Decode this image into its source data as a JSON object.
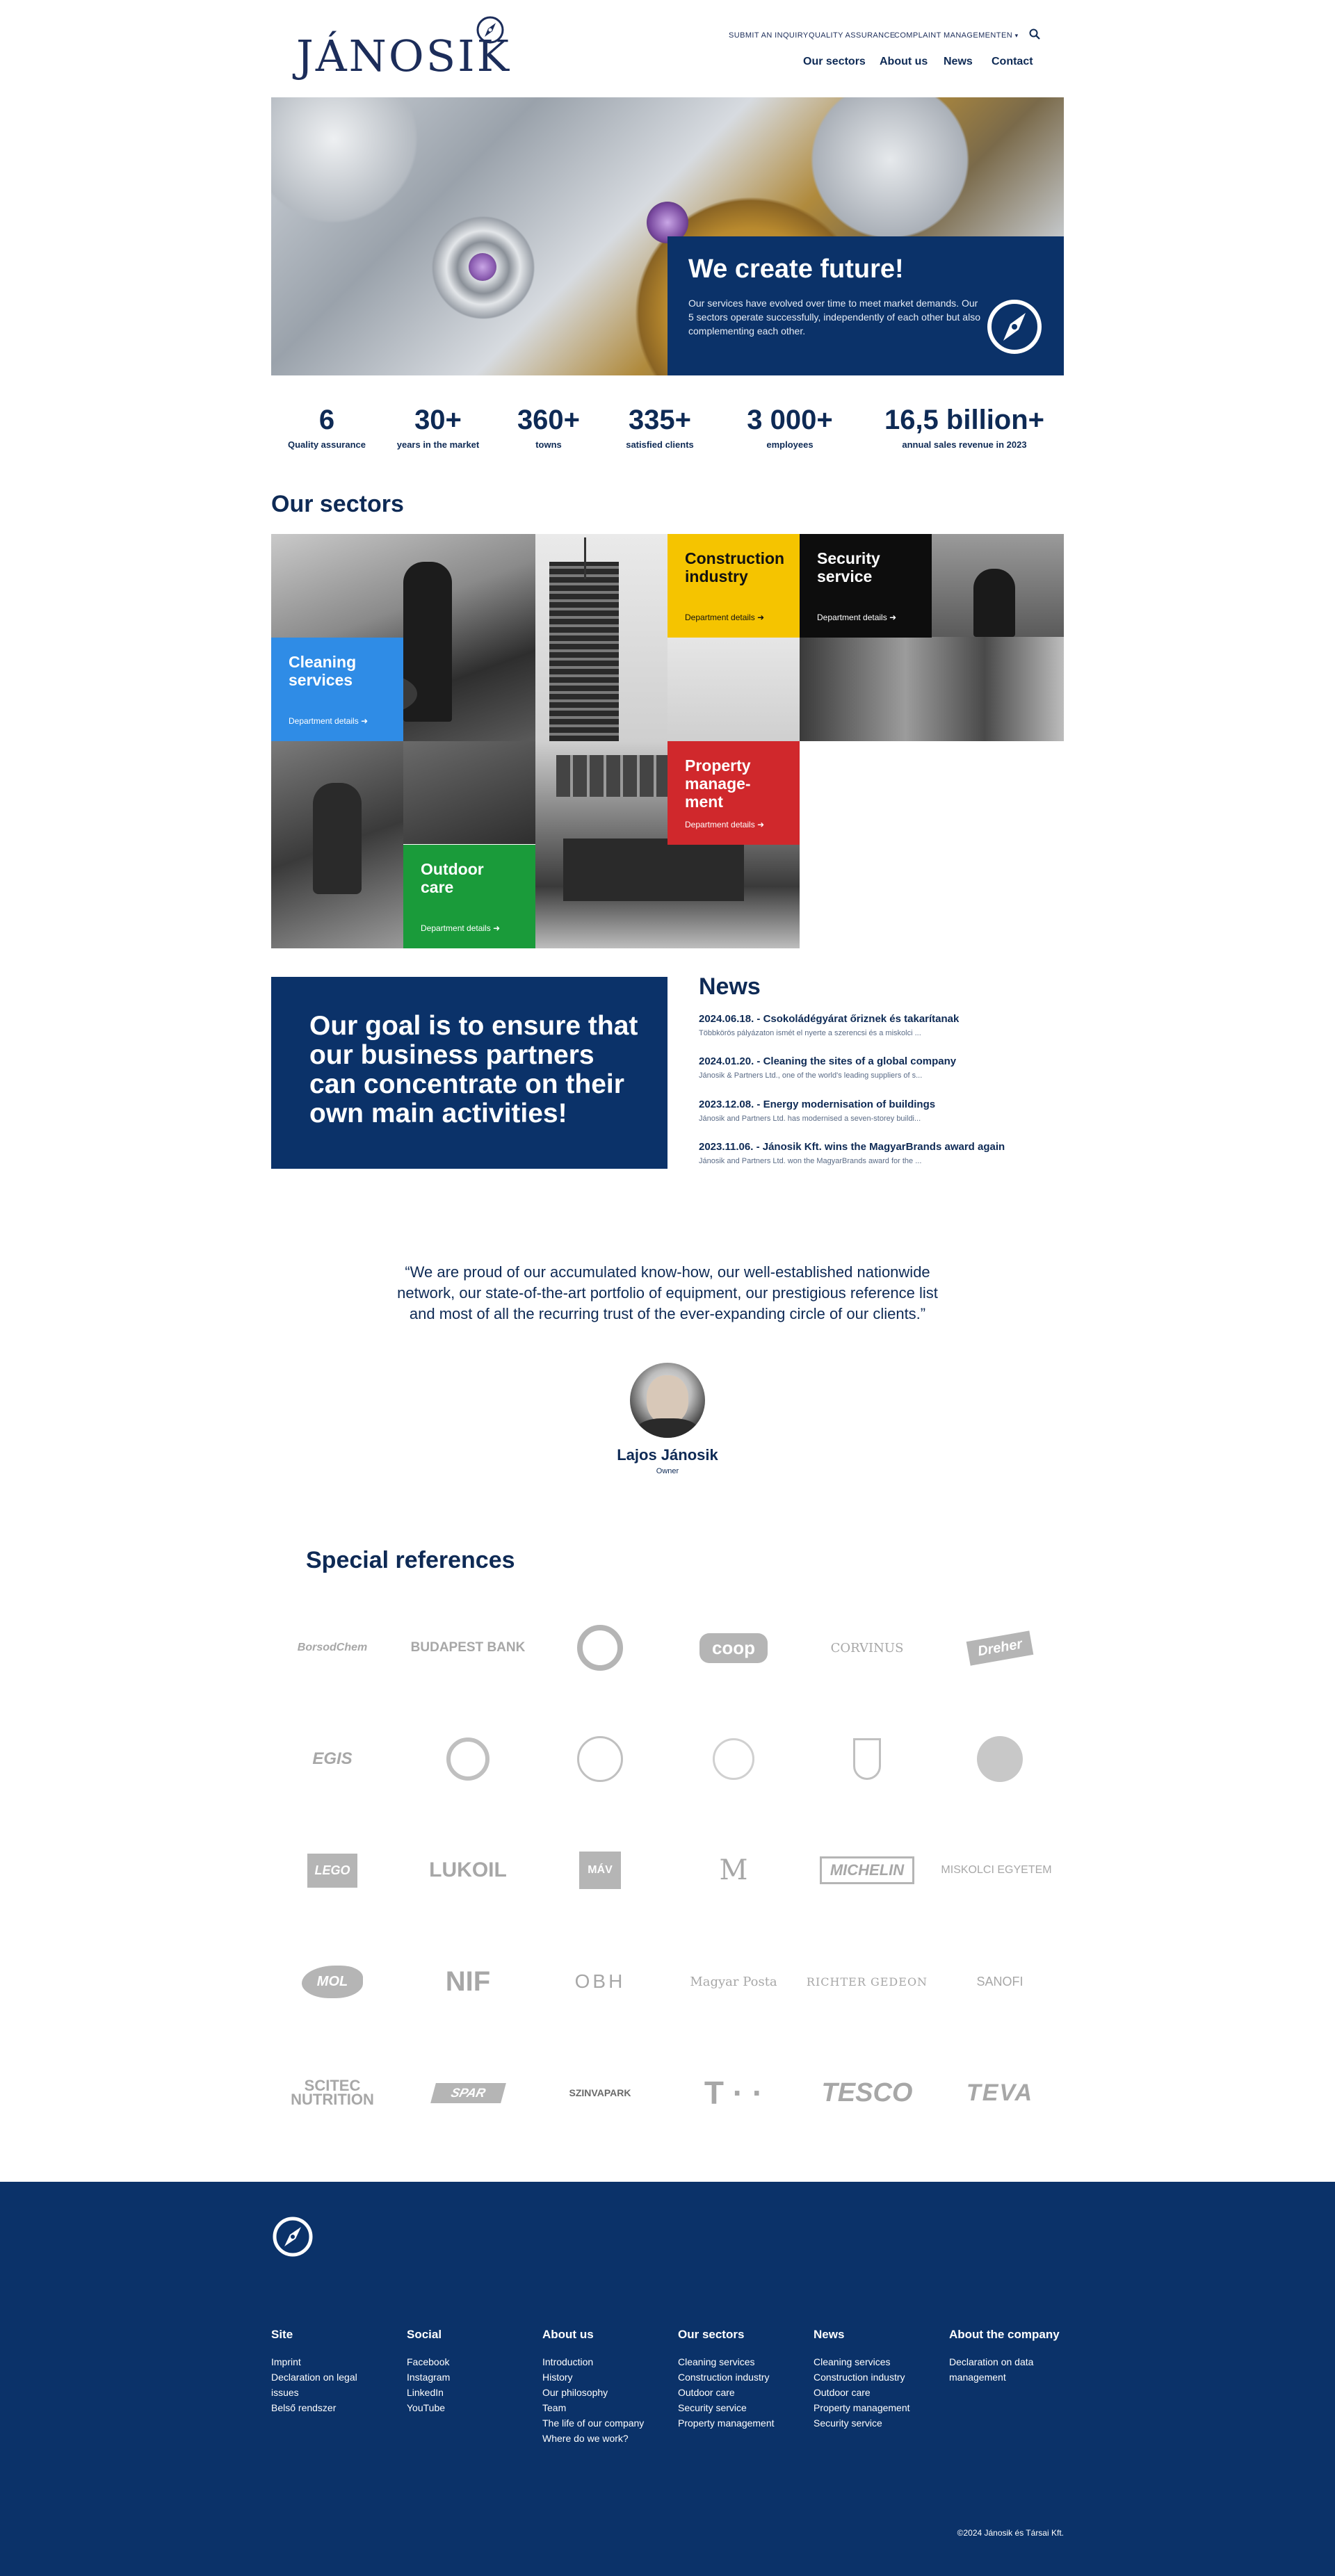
{
  "header": {
    "logo": "JÁNOSIK",
    "util_links": [
      "SUBMIT AN INQUIRY",
      "QUALITY ASSURANCE",
      "COMPLAINT MANAGEMENT"
    ],
    "language": "EN",
    "nav": [
      "Our sectors",
      "About us",
      "News",
      "Contact"
    ]
  },
  "hero": {
    "title": "We create future!",
    "text": "Our services have evolved over time to meet market demands. Our 5 sectors operate successfully, independently of each other but also complementing each other."
  },
  "stats": [
    {
      "value": "6",
      "label": "Quality assurance"
    },
    {
      "value": "30+",
      "label": "years in the market"
    },
    {
      "value": "360+",
      "label": "towns"
    },
    {
      "value": "335+",
      "label": "satisfied clients"
    },
    {
      "value": "3 000+",
      "label": "employees"
    },
    {
      "value": "16,5 billion+",
      "label": "annual sales revenue in 2023"
    }
  ],
  "sectors": {
    "title": "Our sectors",
    "link_label": "Department details",
    "items": [
      {
        "name": "Construction industry",
        "color": "#f5c400",
        "text_color": "#111111"
      },
      {
        "name": "Security service",
        "color": "#0d0d0d",
        "text_color": "#ffffff"
      },
      {
        "name": "Cleaning services",
        "color": "#2f8ce6",
        "text_color": "#ffffff"
      },
      {
        "name": "Property manage-ment",
        "color": "#d0282c",
        "text_color": "#ffffff"
      },
      {
        "name": "Outdoor care",
        "color": "#1a9b3a",
        "text_color": "#ffffff"
      }
    ]
  },
  "goal": {
    "text": "Our goal is to ensure that our business partners can concentrate on their own main activities!"
  },
  "news": {
    "title": "News",
    "items": [
      {
        "headline": "2024.06.18. - Csokoládégyárat őriznek és takarítanak",
        "excerpt": "Többkörös pályázaton ismét el nyerte a szerencsi és a miskolci ..."
      },
      {
        "headline": "2024.01.20. - Cleaning the sites of a global company",
        "excerpt": "Jánosik & Partners Ltd., one of the world's leading suppliers of s..."
      },
      {
        "headline": "2023.12.08. - Energy modernisation of buildings",
        "excerpt": "Jánosik and Partners Ltd. has modernised a seven-storey buildi..."
      },
      {
        "headline": "2023.11.06. - Jánosik Kft. wins the MagyarBrands award again",
        "excerpt": "Jánosik and Partners Ltd. won the MagyarBrands award for the ..."
      }
    ]
  },
  "quote": {
    "text": "“We are proud of our accumulated know-how, our well-established nationwide network, our state-of-the-art portfolio of equipment, our prestigious reference list and most of all the recurring trust of the ever-expanding circle of our clients.”",
    "name": "Lajos Jánosik",
    "role": "Owner"
  },
  "references": {
    "title": "Special references",
    "logos": [
      "BorsodChem",
      "BUDAPEST BANK",
      "",
      "coop",
      "CORVINUS",
      "Dreher",
      "EGIS",
      "",
      "",
      "",
      "",
      "",
      "LEGO",
      "LUKOIL",
      "MÁV",
      "",
      "MICHELIN",
      "MISKOLCI EGYETEM",
      "MOL",
      "NIF",
      "OBH",
      "Magyar Posta",
      "RICHTER GEDEON",
      "SANOFI",
      "SCITEC NUTRITION",
      "SPAR",
      "SZINVAPARK",
      "T · ·",
      "TESCO",
      "TEVA"
    ]
  },
  "footer": {
    "columns": [
      {
        "title": "Site",
        "links": [
          "Imprint",
          "Declaration on legal issues",
          "Belső rendszer"
        ]
      },
      {
        "title": "Social",
        "links": [
          "Facebook",
          "Instagram",
          "LinkedIn",
          "YouTube"
        ]
      },
      {
        "title": "About us",
        "links": [
          "Introduction",
          "History",
          "Our philosophy",
          "Team",
          "The life of our company",
          "Where do we work?"
        ]
      },
      {
        "title": "Our sectors",
        "links": [
          "Cleaning services",
          "Construction industry",
          "Outdoor care",
          "Security service",
          "Property management"
        ]
      },
      {
        "title": "News",
        "links": [
          "Cleaning services",
          "Construction industry",
          "Outdoor care",
          "Property management",
          "Security service"
        ]
      },
      {
        "title": "About the company",
        "links": [
          "Declaration on data management"
        ]
      }
    ],
    "copyright": "©2024 Jánosik és Társai Kft."
  },
  "colors": {
    "brand_navy": "#0b3269",
    "text_navy": "#0e2a55"
  },
  "icons": {
    "search": "search-icon",
    "compass": "compass-icon",
    "arrow": "arrow-right-icon",
    "caret": "chevron-down-icon"
  }
}
